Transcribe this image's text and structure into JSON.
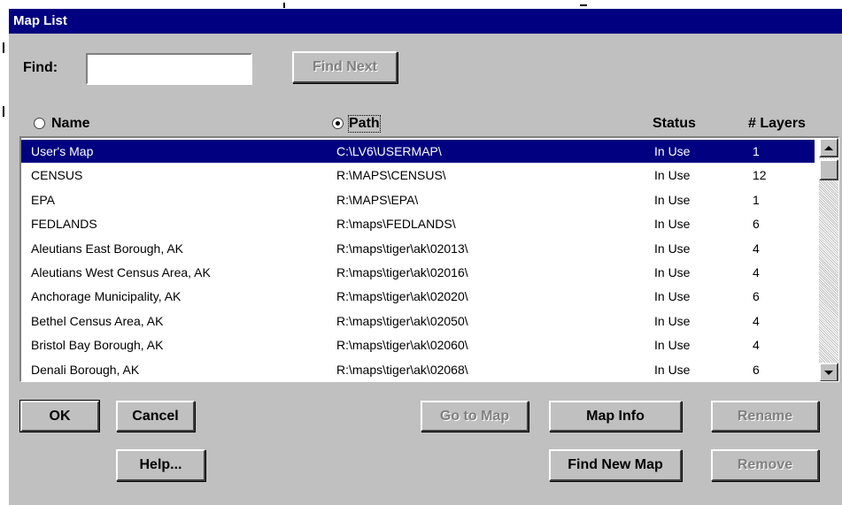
{
  "dialog": {
    "title": "Map List"
  },
  "find": {
    "label": "Find:",
    "value": "",
    "find_next_label": "Find Next"
  },
  "columns": {
    "name": "Name",
    "path": "Path",
    "status": "Status",
    "layers": "# Layers",
    "sort_by": "path"
  },
  "maps": [
    {
      "name": "User's Map",
      "path": "C:\\LV6\\USERMAP\\",
      "status": "In Use",
      "layers": "1",
      "selected": true
    },
    {
      "name": "CENSUS",
      "path": "R:\\MAPS\\CENSUS\\",
      "status": "In Use",
      "layers": "12"
    },
    {
      "name": "EPA",
      "path": "R:\\MAPS\\EPA\\",
      "status": "In Use",
      "layers": "1"
    },
    {
      "name": "FEDLANDS",
      "path": "R:\\maps\\FEDLANDS\\",
      "status": "In Use",
      "layers": "6"
    },
    {
      "name": "Aleutians East Borough, AK",
      "path": "R:\\maps\\tiger\\ak\\02013\\",
      "status": "In Use",
      "layers": "4"
    },
    {
      "name": "Aleutians West Census Area, AK",
      "path": "R:\\maps\\tiger\\ak\\02016\\",
      "status": "In Use",
      "layers": "4"
    },
    {
      "name": "Anchorage Municipality, AK",
      "path": "R:\\maps\\tiger\\ak\\02020\\",
      "status": "In Use",
      "layers": "6"
    },
    {
      "name": "Bethel Census Area, AK",
      "path": "R:\\maps\\tiger\\ak\\02050\\",
      "status": "In Use",
      "layers": "4"
    },
    {
      "name": "Bristol Bay Borough, AK",
      "path": "R:\\maps\\tiger\\ak\\02060\\",
      "status": "In Use",
      "layers": "4"
    },
    {
      "name": "Denali Borough, AK",
      "path": "R:\\maps\\tiger\\ak\\02068\\",
      "status": "In Use",
      "layers": "6"
    }
  ],
  "buttons": {
    "ok": "OK",
    "cancel": "Cancel",
    "help": "Help...",
    "go_to_map": "Go to Map",
    "map_info": "Map Info",
    "rename": "Rename",
    "find_new_map": "Find New Map",
    "remove": "Remove"
  },
  "colors": {
    "titlebar": "#000080",
    "face": "#c0c0c0",
    "selection": "#000080",
    "disabled_text": "#808080"
  }
}
